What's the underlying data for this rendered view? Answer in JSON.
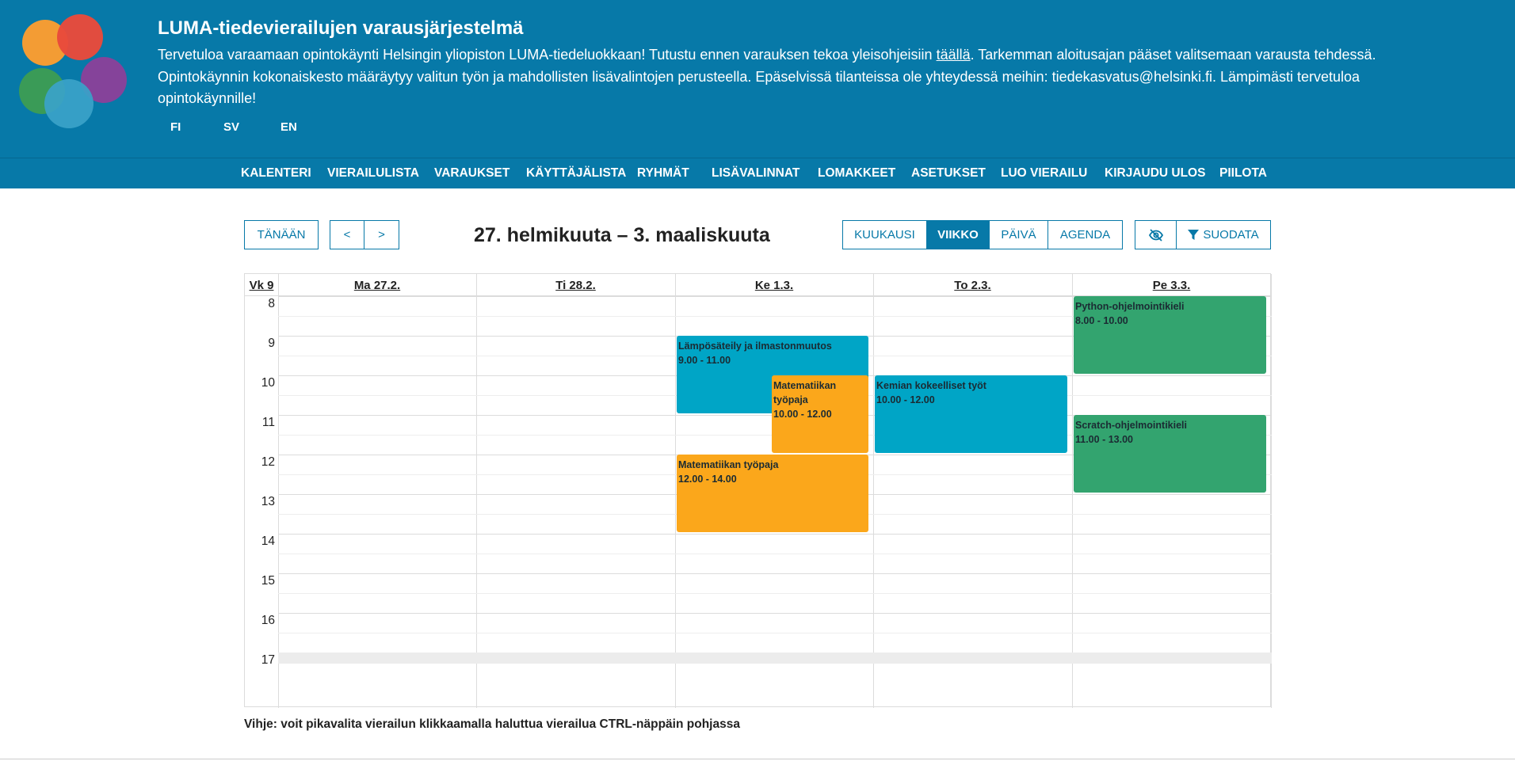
{
  "header": {
    "title": "LUMA-tiedevierailujen varausjärjestelmä",
    "intro_before_link": "Tervetuloa varaamaan opintokäynti Helsingin yliopiston LUMA-tiedeluokkaan! Tutustu ennen varauksen tekoa yleisohjeisiin ",
    "intro_link": "täällä",
    "intro_after_link": ". Tarkemman aloitusajan pääset valitsemaan varausta tehdessä. Opintokäynnin kokonaiskesto määräytyy valitun työn ja mahdollisten lisävalintojen perusteella. Epäselvissä tilanteissa ole yhteydessä meihin: tiedekasvatus@helsinki.fi. Lämpimästi tervetuloa opintokäynnille!",
    "languages": [
      "FI",
      "SV",
      "EN"
    ]
  },
  "nav": [
    "KALENTERI",
    "VIERAILULISTA",
    "VARAUKSET",
    "KÄYTTÄJÄLISTA",
    "RYHMÄT",
    "LISÄVALINNAT",
    "LOMAKKEET",
    "ASETUKSET",
    "LUO VIERAILU",
    "KIRJAUDU ULOS",
    "PIILOTA"
  ],
  "toolbar": {
    "today": "TÄNÄÄN",
    "prev": "<",
    "next": ">",
    "range": "27. helmikuuta – 3. maaliskuuta",
    "views": [
      "KUUKAUSI",
      "VIIKKO",
      "PÄIVÄ",
      "AGENDA"
    ],
    "active_view": "VIIKKO",
    "filter": "SUODATA"
  },
  "calendar": {
    "week_label": "Vk 9",
    "days": [
      "Ma 27.2.",
      "Ti 28.2.",
      "Ke 1.3.",
      "To 2.3.",
      "Pe 3.3."
    ],
    "hours": [
      "8",
      "9",
      "10",
      "11",
      "12",
      "13",
      "14",
      "15",
      "16",
      "17"
    ],
    "events": [
      {
        "title": "Lämpösäteily ja ilmastonmuutos",
        "time": "9.00 - 11.00",
        "day": 2,
        "start": 9,
        "end": 11,
        "color": "#00a5c6",
        "lane": "left"
      },
      {
        "title": "Matematiikan työpaja",
        "time": "10.00 - 12.00",
        "day": 2,
        "start": 10,
        "end": 12,
        "color": "#fba71b",
        "lane": "right"
      },
      {
        "title": "Matematiikan työpaja",
        "time": "12.00 - 14.00",
        "day": 2,
        "start": 12,
        "end": 14,
        "color": "#fba71b",
        "lane": "full"
      },
      {
        "title": "Kemian kokeelliset työt",
        "time": "10.00 - 12.00",
        "day": 3,
        "start": 10,
        "end": 12,
        "color": "#00a5c6",
        "lane": "full"
      },
      {
        "title": "Python-ohjelmointikieli",
        "time": "8.00 - 10.00",
        "day": 4,
        "start": 8,
        "end": 10,
        "color": "#33a46f",
        "lane": "full"
      },
      {
        "title": "Scratch-ohjelmointikieli",
        "time": "11.00 - 13.00",
        "day": 4,
        "start": 11,
        "end": 13,
        "color": "#33a46f",
        "lane": "full"
      }
    ]
  },
  "hint": "Vihje: voit pikavalita vierailun klikkaamalla haluttua vierailua CTRL-näppäin pohjassa",
  "colors": {
    "brand": "#0779a8",
    "blue_event": "#00a5c6",
    "orange_event": "#fba71b",
    "green_event": "#33a46f"
  }
}
